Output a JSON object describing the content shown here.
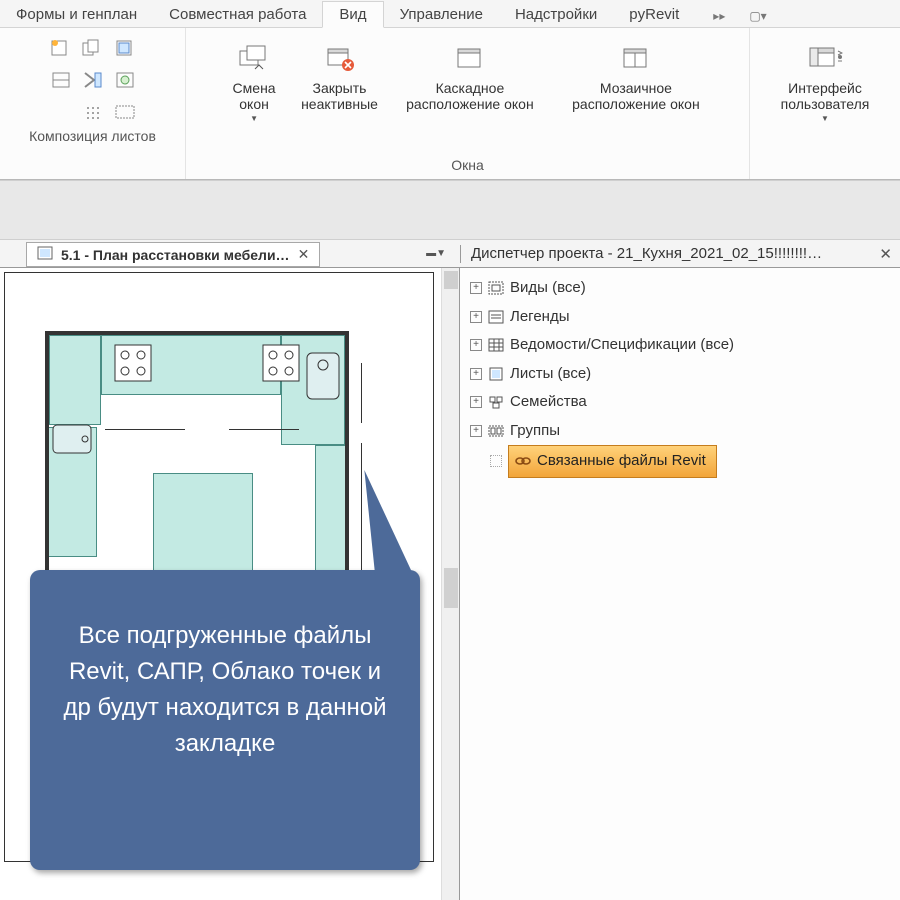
{
  "ribbon": {
    "tabs": [
      "Формы и генплан",
      "Совместная работа",
      "Вид",
      "Управление",
      "Надстройки",
      "pyRevit"
    ],
    "active_index": 2,
    "groups": {
      "composition": {
        "label": "Композиция листов"
      },
      "windows": {
        "label": "Окна",
        "switch_windows": "Смена\nокон",
        "close_inactive": "Закрыть\nнеактивные",
        "cascade": "Каскадное\nрасположение окон",
        "tile": "Мозаичное\nрасположение окон"
      },
      "ui": {
        "label": "Интерфейс\nпользователя"
      }
    }
  },
  "doc_tab": {
    "title": "5.1 - План расстановки мебели…"
  },
  "browser": {
    "title": "Диспетчер проекта - 21_Кухня_2021_02_15!!!!!!!!…",
    "items": [
      {
        "label": "Виды (все)"
      },
      {
        "label": "Легенды"
      },
      {
        "label": "Ведомости/Спецификации (все)"
      },
      {
        "label": "Листы (все)"
      },
      {
        "label": "Семейства"
      },
      {
        "label": "Группы"
      },
      {
        "label": "Связанные файлы Revit",
        "highlight": true
      }
    ]
  },
  "callout": {
    "text": "Все подгруженные файлы Revit, САПР, Облако точек и др будут находится в данной закладке"
  }
}
